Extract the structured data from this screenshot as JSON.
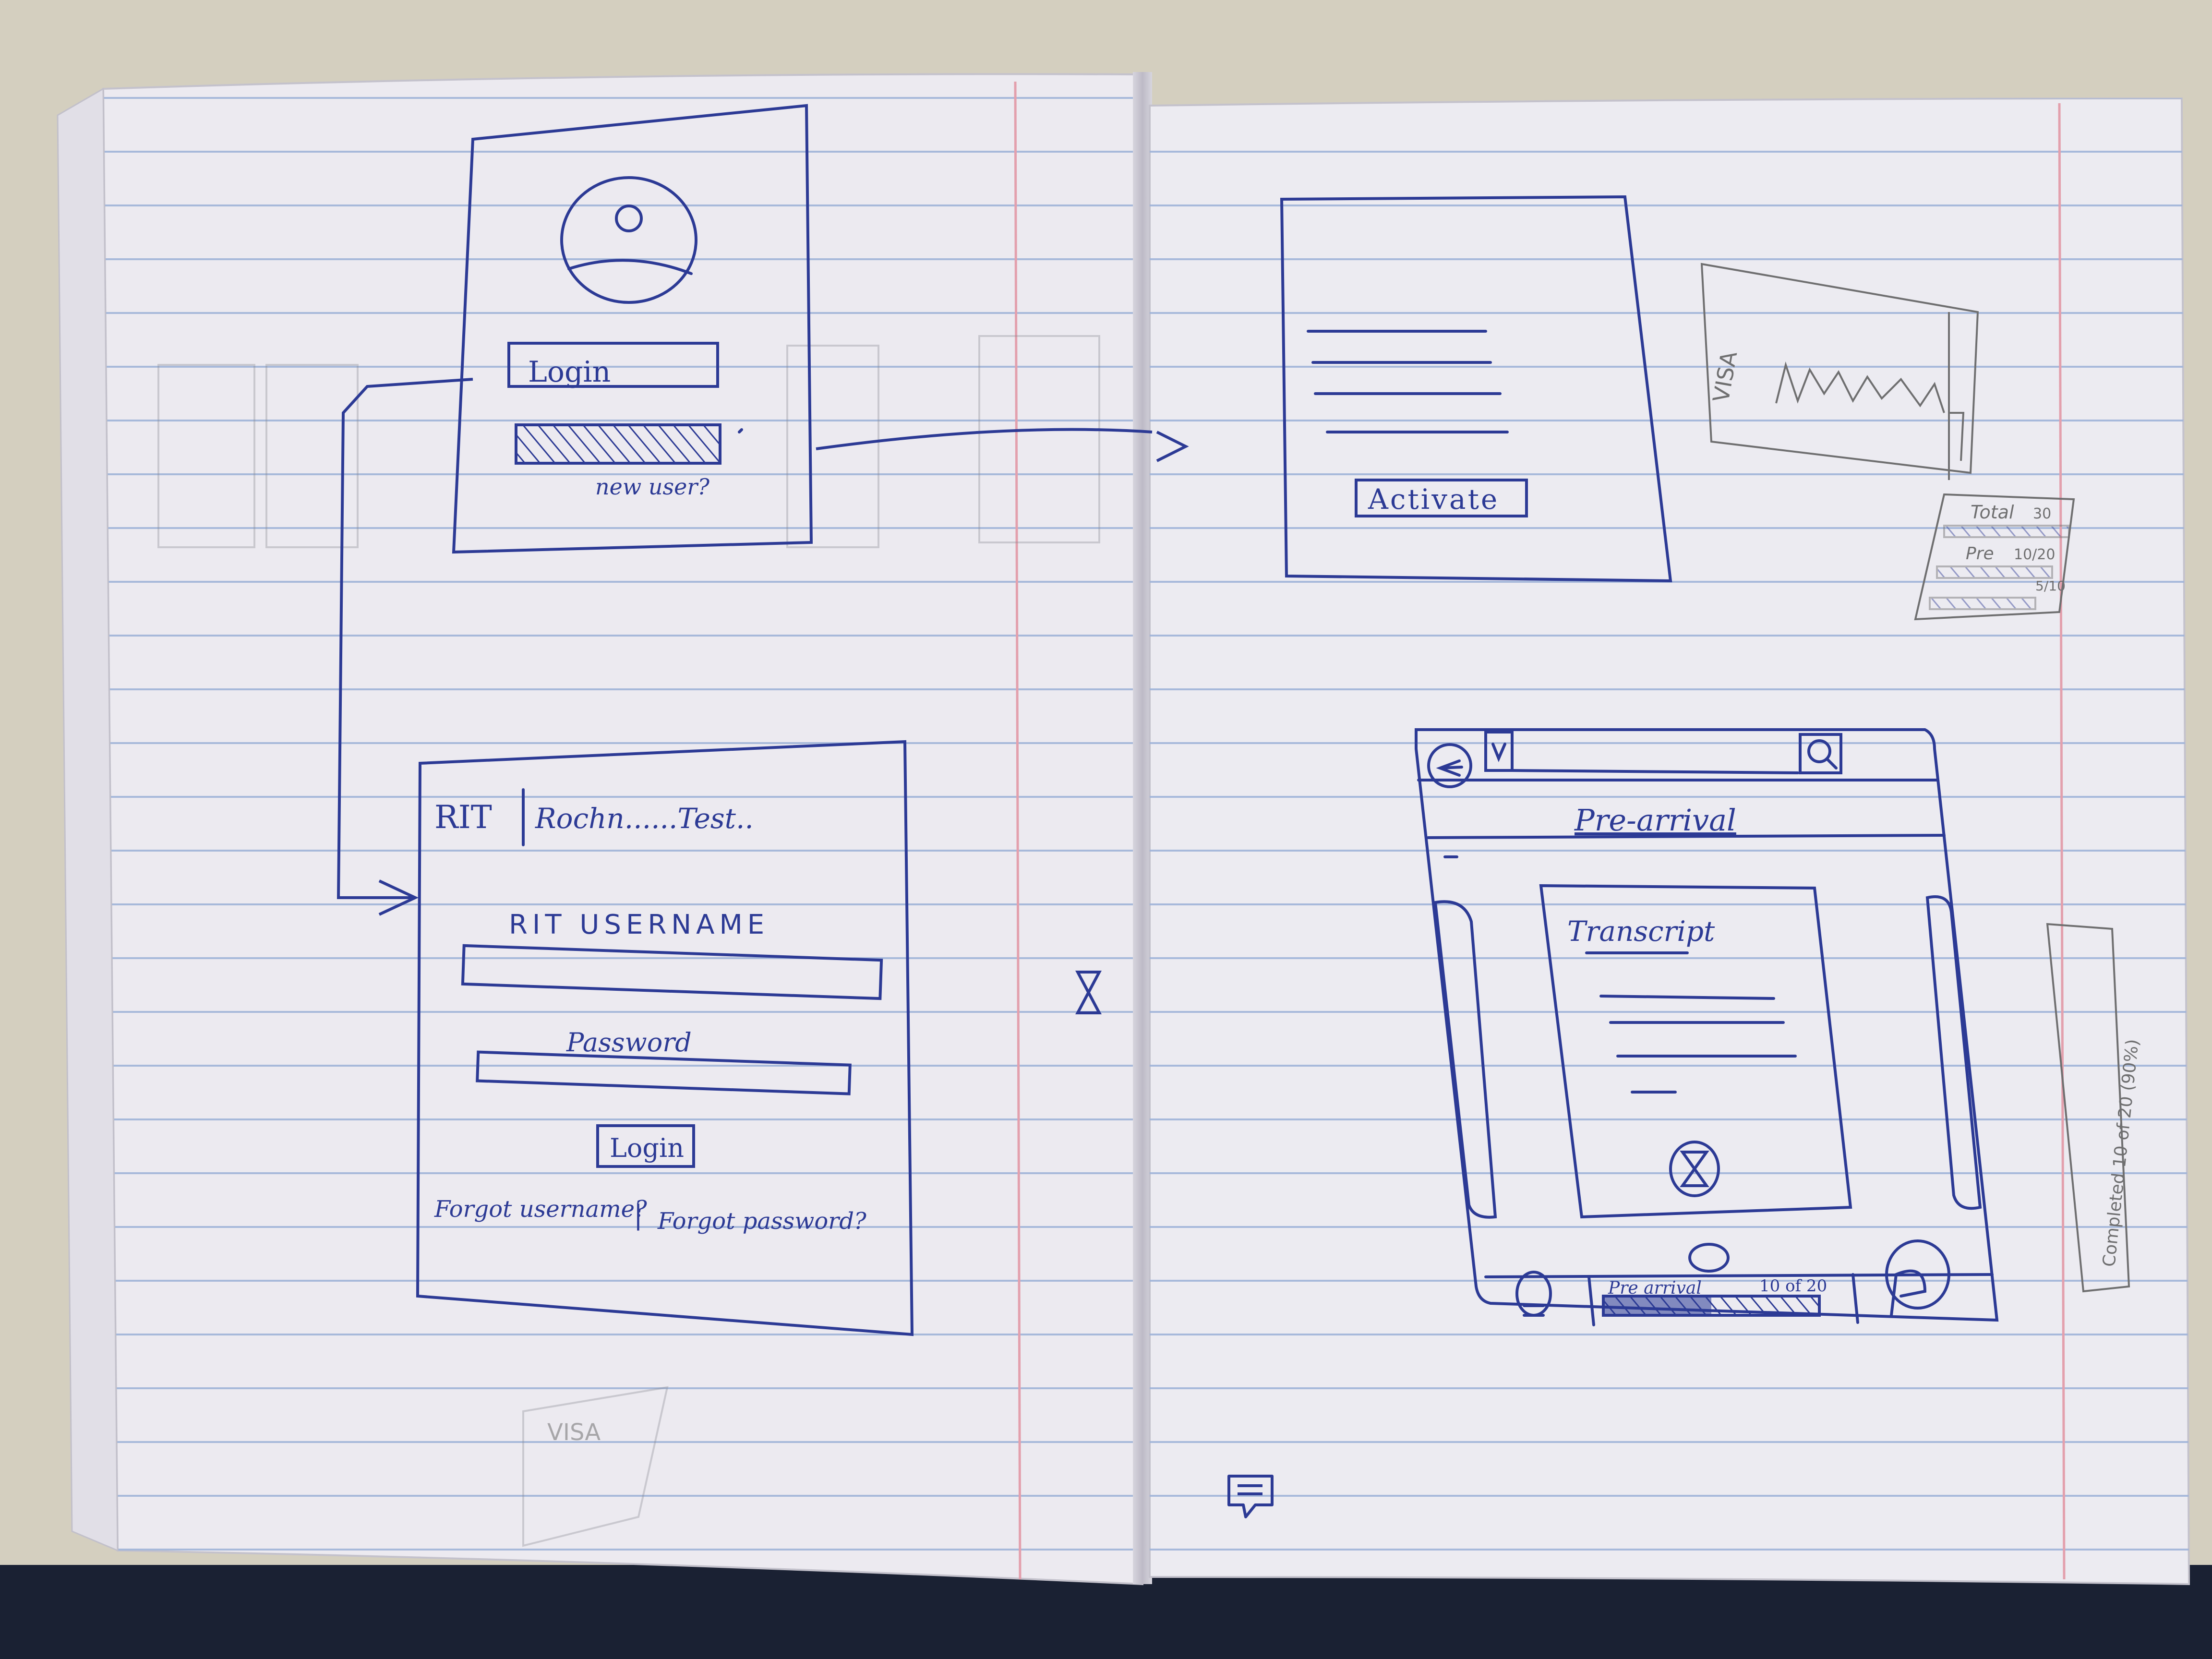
{
  "colors": {
    "desk": "#cbc6b7",
    "paper": "#ecebf1",
    "rule_line": "#9fb3d8",
    "margin_line": "#e3a0ad",
    "ink": "#2c3a95",
    "pencil": "#6f6f70"
  },
  "login_screen": {
    "avatar_icon": "user-avatar-icon",
    "login_field_text": "Login",
    "password_field": "hatched-password-field",
    "new_user_link": "new user?"
  },
  "rit_login_screen": {
    "header_logo": "RIT",
    "header_title": "Rochn......Test..",
    "username_label": "RIT USERNAME",
    "password_label": "Password",
    "login_button": "Login",
    "forgot_username_link": "Forgot username?",
    "separator": "|",
    "forgot_password_link": "Forgot password?"
  },
  "activate_screen": {
    "activate_button": "Activate"
  },
  "visa_card_sketch": {
    "label": "VISA"
  },
  "stats_sketch": {
    "total_label": "Total",
    "total_value": "30",
    "pre_label": "Pre",
    "pre_value": "10/20",
    "post_value": "5/10"
  },
  "preview_screen": {
    "back_icon": "back-arrow-icon",
    "dropdown_icon": "chevron-down-icon",
    "search_icon": "search-icon",
    "title": "Pre-arrival",
    "card_title": "Transcript",
    "hourglass_icon": "hourglass-icon",
    "bottom_bar": {
      "menu_icon": "menu-icon",
      "label": "Pre arrival",
      "count": "10 of 20",
      "progress": 0.5,
      "profile_icon": "profile-icon"
    }
  },
  "side_note": {
    "text": "Completed 10 of 20 (90%)"
  },
  "loose_icons": {
    "hourglass": "hourglass-icon",
    "chat": "chat-icon"
  }
}
